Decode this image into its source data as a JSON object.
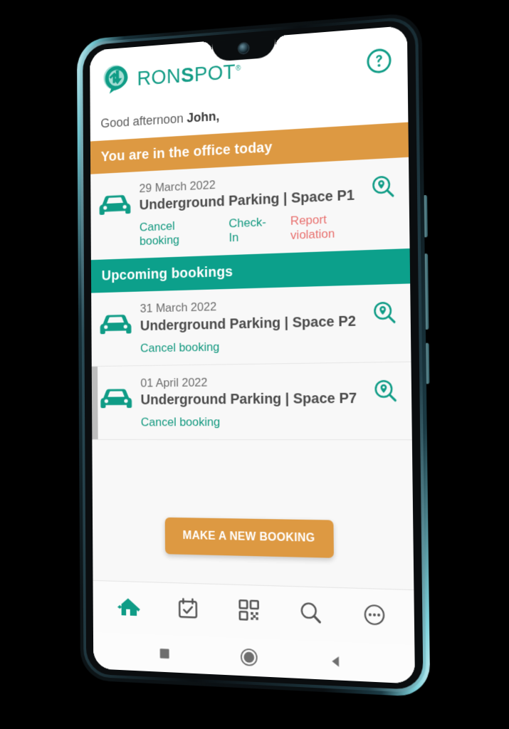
{
  "app": {
    "brand_name_plain": "RON",
    "brand_name_bold": "S",
    "brand_name_tail": "POT",
    "brand_registered": "®",
    "brand_full": "RONSPOT®",
    "accent_teal": "#0CA08B",
    "accent_orange": "#DD9942",
    "danger_red": "#E8706E"
  },
  "header": {
    "logo_icon": "ronspot-pin-logo",
    "help_icon": "question-mark-circle-icon",
    "help_label": "Help"
  },
  "greeting": {
    "text": "Good afternoon ",
    "user": "John,"
  },
  "sections": [
    {
      "id": "today",
      "title": "You are in the office today",
      "color": "#DD9942"
    },
    {
      "id": "upcoming",
      "title": "Upcoming bookings",
      "color": "#0CA08B"
    }
  ],
  "bookings": {
    "today": [
      {
        "icon": "car-icon",
        "date": "29 March 2022",
        "location": "Underground Parking | Space P1",
        "actions": [
          {
            "label": "Cancel booking",
            "kind": "link"
          },
          {
            "label": "Check-In",
            "kind": "link"
          },
          {
            "label": "Report violation",
            "kind": "danger"
          }
        ],
        "map_icon": "map-search-pin-icon"
      }
    ],
    "upcoming": [
      {
        "icon": "car-icon",
        "date": "31 March 2022",
        "location": "Underground Parking | Space P2",
        "actions": [
          {
            "label": "Cancel booking",
            "kind": "link"
          }
        ],
        "map_icon": "map-search-pin-icon"
      },
      {
        "icon": "car-icon",
        "date": "01 April 2022",
        "location": "Underground Parking | Space P7",
        "actions": [
          {
            "label": "Cancel booking",
            "kind": "link"
          }
        ],
        "map_icon": "map-search-pin-icon"
      }
    ]
  },
  "cta": {
    "label": "MAKE A NEW BOOKING"
  },
  "tabbar": [
    {
      "id": "home",
      "icon": "home-icon",
      "active": true
    },
    {
      "id": "calendar",
      "icon": "calendar-check-icon",
      "active": false
    },
    {
      "id": "qr",
      "icon": "qr-code-icon",
      "active": false
    },
    {
      "id": "search",
      "icon": "magnifier-icon",
      "active": false
    },
    {
      "id": "more",
      "icon": "more-dots-circle-icon",
      "active": false
    }
  ],
  "system_nav": [
    {
      "id": "recents",
      "icon": "square-recents-icon"
    },
    {
      "id": "home",
      "icon": "circle-home-icon"
    },
    {
      "id": "back",
      "icon": "triangle-back-icon"
    }
  ]
}
